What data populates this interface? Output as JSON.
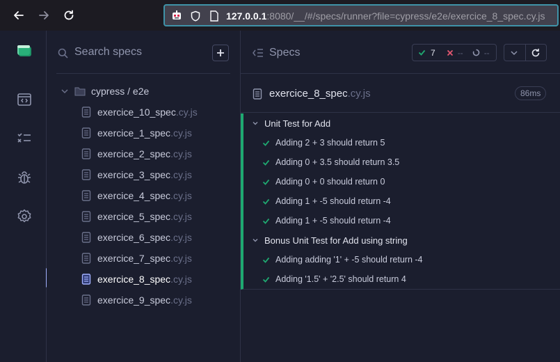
{
  "browser": {
    "url_host": "127.0.0.1",
    "url_rest": ":8080/__/#/specs/runner?file=cypress/e2e/exercice_8_spec.cy.js"
  },
  "nav": {
    "icons": [
      "cypress-logo-icon",
      "runs-icon",
      "specs-list-icon",
      "debug-icon",
      "settings-icon"
    ]
  },
  "specs_panel": {
    "search_placeholder": "Search specs",
    "folder": "cypress / e2e",
    "ext": ".cy.js",
    "items": [
      {
        "name": "exercice_10_spec",
        "active": false
      },
      {
        "name": "exercice_1_spec",
        "active": false
      },
      {
        "name": "exercice_2_spec",
        "active": false
      },
      {
        "name": "exercice_3_spec",
        "active": false
      },
      {
        "name": "exercice_4_spec",
        "active": false
      },
      {
        "name": "exercice_5_spec",
        "active": false
      },
      {
        "name": "exercice_6_spec",
        "active": false
      },
      {
        "name": "exercice_7_spec",
        "active": false
      },
      {
        "name": "exercice_8_spec",
        "active": true
      },
      {
        "name": "exercice_9_spec",
        "active": false
      }
    ]
  },
  "reporter": {
    "title": "Specs",
    "passed": "7",
    "failed": "--",
    "pending": "--",
    "file_name": "exercice_8_spec",
    "file_ext": ".cy.js",
    "duration": "86ms",
    "suites": [
      {
        "title": "Unit Test for Add",
        "tests": [
          "Adding 2 + 3 should return 5",
          "Adding 0 + 3.5 should return 3.5",
          "Adding 0 + 0 should return 0",
          "Adding 1 + -5 should return -4",
          "Adding 1 + -5 should return -4"
        ]
      },
      {
        "title": "Bonus Unit Test for Add using string",
        "tests": [
          "Adding adding '1' + -5 should return -4",
          "Adding '1.5' + '2.5' should return 4"
        ]
      }
    ]
  },
  "colors": {
    "pass": "#1fa971",
    "fail": "#e45770",
    "accent": "#a3b1ff"
  }
}
